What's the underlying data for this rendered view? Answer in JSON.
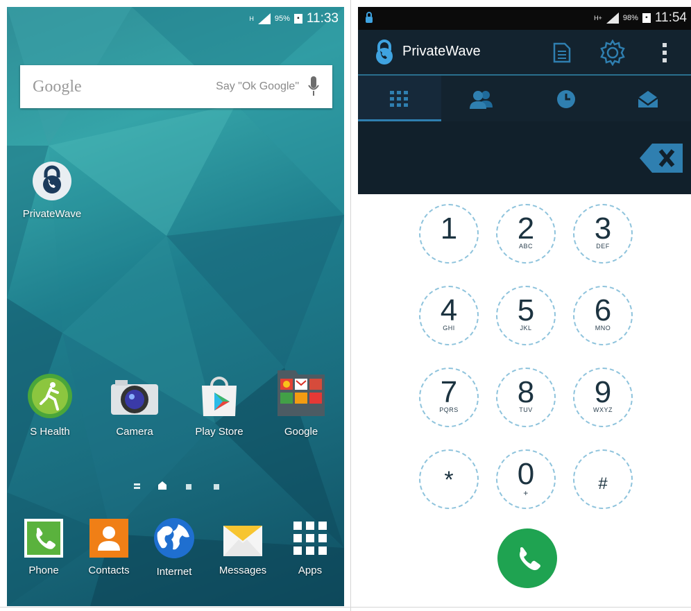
{
  "home": {
    "status": {
      "net": "H",
      "battery_pct": "95%",
      "time": "11:33"
    },
    "search": {
      "brand": "Google",
      "hint": "Say \"Ok Google\""
    },
    "desktop_app": {
      "label": "PrivateWave"
    },
    "apps": [
      {
        "label": "S Health",
        "icon": "s-health-icon"
      },
      {
        "label": "Camera",
        "icon": "camera-icon"
      },
      {
        "label": "Play Store",
        "icon": "play-store-icon"
      },
      {
        "label": "Google",
        "icon": "google-folder-icon"
      }
    ],
    "dock": [
      {
        "label": "Phone",
        "icon": "phone-icon"
      },
      {
        "label": "Contacts",
        "icon": "contacts-icon"
      },
      {
        "label": "Internet",
        "icon": "globe-icon"
      },
      {
        "label": "Messages",
        "icon": "envelope-icon"
      },
      {
        "label": "Apps",
        "icon": "apps-grid-icon"
      }
    ]
  },
  "dialer": {
    "status": {
      "net": "H+",
      "battery_pct": "98%",
      "time": "11:54"
    },
    "app_title": "PrivateWave",
    "tabs": [
      "dialpad-icon",
      "contacts-icon",
      "recents-clock-icon",
      "messages-envelope-icon"
    ],
    "active_tab": 0,
    "keys": [
      {
        "digit": "1",
        "letters": ""
      },
      {
        "digit": "2",
        "letters": "ABC"
      },
      {
        "digit": "3",
        "letters": "DEF"
      },
      {
        "digit": "4",
        "letters": "GHI"
      },
      {
        "digit": "5",
        "letters": "JKL"
      },
      {
        "digit": "6",
        "letters": "MNO"
      },
      {
        "digit": "7",
        "letters": "PQRS"
      },
      {
        "digit": "8",
        "letters": "TUV"
      },
      {
        "digit": "9",
        "letters": "WXYZ"
      },
      {
        "digit": "*",
        "letters": ""
      },
      {
        "digit": "0",
        "letters": "+"
      },
      {
        "digit": "#",
        "letters": ""
      }
    ],
    "colors": {
      "accent": "#2f7fb0",
      "call": "#1fa351",
      "bar": "#13232f"
    }
  }
}
